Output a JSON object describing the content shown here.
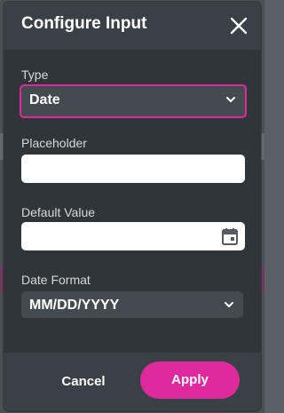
{
  "dialog": {
    "title": "Configure Input",
    "close_icon": "close-icon"
  },
  "fields": {
    "type": {
      "label": "Type",
      "value": "Date"
    },
    "placeholder": {
      "label": "Placeholder",
      "value": ""
    },
    "default_value": {
      "label": "Default Value",
      "value": "",
      "icon": "calendar-icon"
    },
    "date_format": {
      "label": "Date Format",
      "value": "MM/DD/YYYY"
    }
  },
  "footer": {
    "cancel_label": "Cancel",
    "apply_label": "Apply"
  },
  "colors": {
    "accent": "#e0299c",
    "dialog_bg": "#2f3539",
    "header_bg": "#3a4146",
    "select_bg": "#434b50"
  }
}
